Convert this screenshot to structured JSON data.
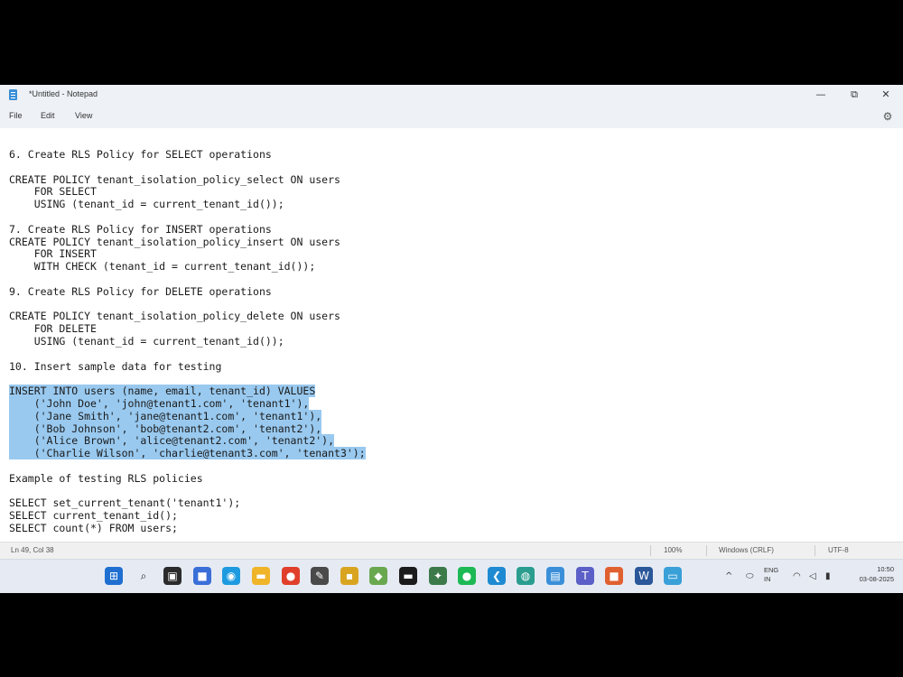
{
  "window": {
    "title": "*Untitled - Notepad",
    "minimize": "—",
    "maximize": "⧉",
    "close": "✕"
  },
  "menu": {
    "file": "File",
    "edit": "Edit",
    "view": "View"
  },
  "editor": {
    "lines": [
      "6. Create RLS Policy for SELECT operations",
      "",
      "CREATE POLICY tenant_isolation_policy_select ON users",
      "    FOR SELECT",
      "    USING (tenant_id = current_tenant_id());",
      "",
      "7. Create RLS Policy for INSERT operations",
      "CREATE POLICY tenant_isolation_policy_insert ON users",
      "    FOR INSERT",
      "    WITH CHECK (tenant_id = current_tenant_id());",
      "",
      "9. Create RLS Policy for DELETE operations",
      "",
      "CREATE POLICY tenant_isolation_policy_delete ON users",
      "    FOR DELETE",
      "    USING (tenant_id = current_tenant_id());",
      "",
      "10. Insert sample data for testing",
      "",
      "INSERT INTO users (name, email, tenant_id) VALUES",
      "    ('John Doe', 'john@tenant1.com', 'tenant1'),",
      "    ('Jane Smith', 'jane@tenant1.com', 'tenant1'),",
      "    ('Bob Johnson', 'bob@tenant2.com', 'tenant2'),",
      "    ('Alice Brown', 'alice@tenant2.com', 'tenant2'),",
      "    ('Charlie Wilson', 'charlie@tenant3.com', 'tenant3');",
      "",
      "Example of testing RLS policies",
      "",
      "SELECT set_current_tenant('tenant1');",
      "SELECT current_tenant_id();",
      "SELECT count(*) FROM users;"
    ],
    "selected_range": [
      19,
      24
    ]
  },
  "status": {
    "position": "Ln 49, Col 38",
    "zoom": "100%",
    "line_ending": "Windows (CRLF)",
    "encoding": "UTF-8"
  },
  "taskbar": {
    "icons": [
      {
        "name": "start-icon",
        "color": "#1f6fd1",
        "glyph": "⊞"
      },
      {
        "name": "search-icon",
        "color": "transparent",
        "glyph": "⌕"
      },
      {
        "name": "task-view-icon",
        "color": "#2b2b2b",
        "glyph": "▣"
      },
      {
        "name": "meet-icon",
        "color": "#3a6fd8",
        "glyph": "■"
      },
      {
        "name": "edge-icon",
        "color": "#1e9be0",
        "glyph": "◉"
      },
      {
        "name": "file-explorer-icon",
        "color": "#f0b429",
        "glyph": "▬"
      },
      {
        "name": "chrome-icon",
        "color": "#e0402b",
        "glyph": "●"
      },
      {
        "name": "app-icon-1",
        "color": "#4a4a4a",
        "glyph": "✎"
      },
      {
        "name": "app-icon-2",
        "color": "#d9a521",
        "glyph": "▪"
      },
      {
        "name": "app-icon-3",
        "color": "#6aa84f",
        "glyph": "◆"
      },
      {
        "name": "terminal-icon",
        "color": "#1b1b1b",
        "glyph": "▬"
      },
      {
        "name": "app-icon-4",
        "color": "#3c7a4a",
        "glyph": "✦"
      },
      {
        "name": "spotify-icon",
        "color": "#1db954",
        "glyph": "●"
      },
      {
        "name": "vscode-icon",
        "color": "#1f8ad2",
        "glyph": "❮"
      },
      {
        "name": "app-icon-5",
        "color": "#2a9d8f",
        "glyph": "◍"
      },
      {
        "name": "notepad-icon",
        "color": "#3a8fd8",
        "glyph": "▤"
      },
      {
        "name": "teams-icon",
        "color": "#5b5fc7",
        "glyph": "T"
      },
      {
        "name": "app-icon-6",
        "color": "#e06030",
        "glyph": "■"
      },
      {
        "name": "word-icon",
        "color": "#2b579a",
        "glyph": "W"
      },
      {
        "name": "app-icon-7",
        "color": "#3aa0d8",
        "glyph": "▭"
      }
    ],
    "tray": {
      "chevron": "^",
      "lang_line1": "ENG",
      "lang_line2": "IN",
      "time": "10:50",
      "date": "03-08-2025"
    }
  }
}
